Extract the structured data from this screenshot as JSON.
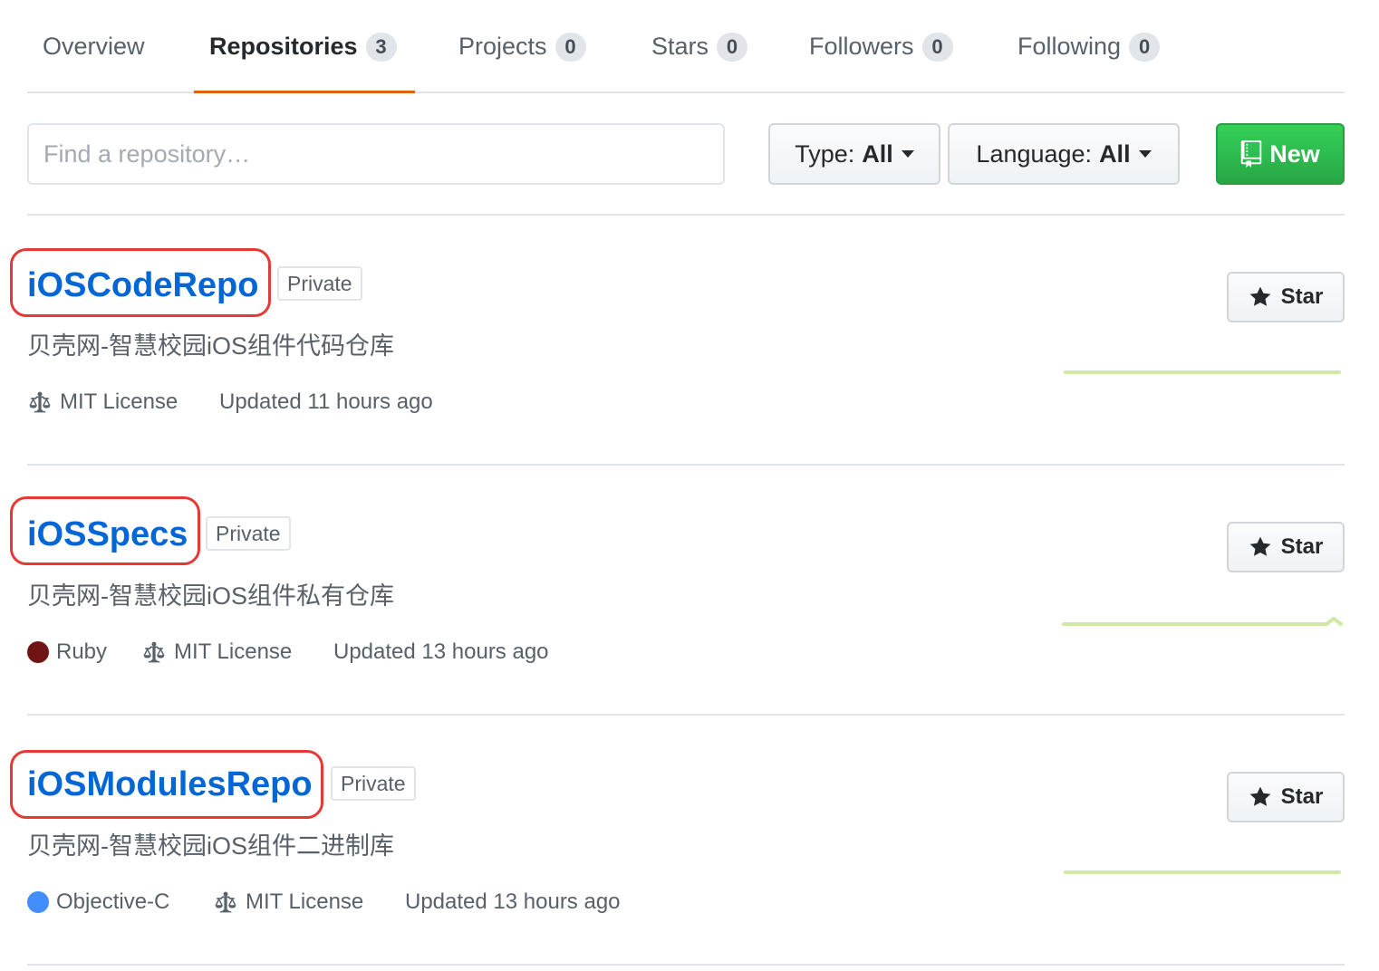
{
  "tabs": [
    {
      "label": "Overview",
      "count": null
    },
    {
      "label": "Repositories",
      "count": "3"
    },
    {
      "label": "Projects",
      "count": "0"
    },
    {
      "label": "Stars",
      "count": "0"
    },
    {
      "label": "Followers",
      "count": "0"
    },
    {
      "label": "Following",
      "count": "0"
    }
  ],
  "filters": {
    "search_placeholder": "Find a repository…",
    "type_label": "Type:",
    "type_value": "All",
    "language_label": "Language:",
    "language_value": "All",
    "new_label": "New"
  },
  "repos": [
    {
      "name": "iOSCodeRepo",
      "visibility": "Private",
      "description": "贝壳网-智慧校园iOS组件代码仓库",
      "language": null,
      "license": "MIT License",
      "updated": "Updated 11 hours ago",
      "star_label": "Star"
    },
    {
      "name": "iOSSpecs",
      "visibility": "Private",
      "description": "贝壳网-智慧校园iOS组件私有仓库",
      "language": "Ruby",
      "license": "MIT License",
      "updated": "Updated 13 hours ago",
      "star_label": "Star"
    },
    {
      "name": "iOSModulesRepo",
      "visibility": "Private",
      "description": "贝壳网-智慧校园iOS组件二进制库",
      "language": "Objective-C",
      "license": "MIT License",
      "updated": "Updated 13 hours ago",
      "star_label": "Star"
    }
  ],
  "colors": {
    "accent": "#0366d6",
    "selected_tab_underline": "#e36209",
    "new_button": "#28a745",
    "highlight": "#e53935",
    "ruby": "#701516",
    "objective_c": "#438eff"
  },
  "icons": {
    "license": "law-icon",
    "star": "star-icon",
    "new": "repo-icon"
  }
}
